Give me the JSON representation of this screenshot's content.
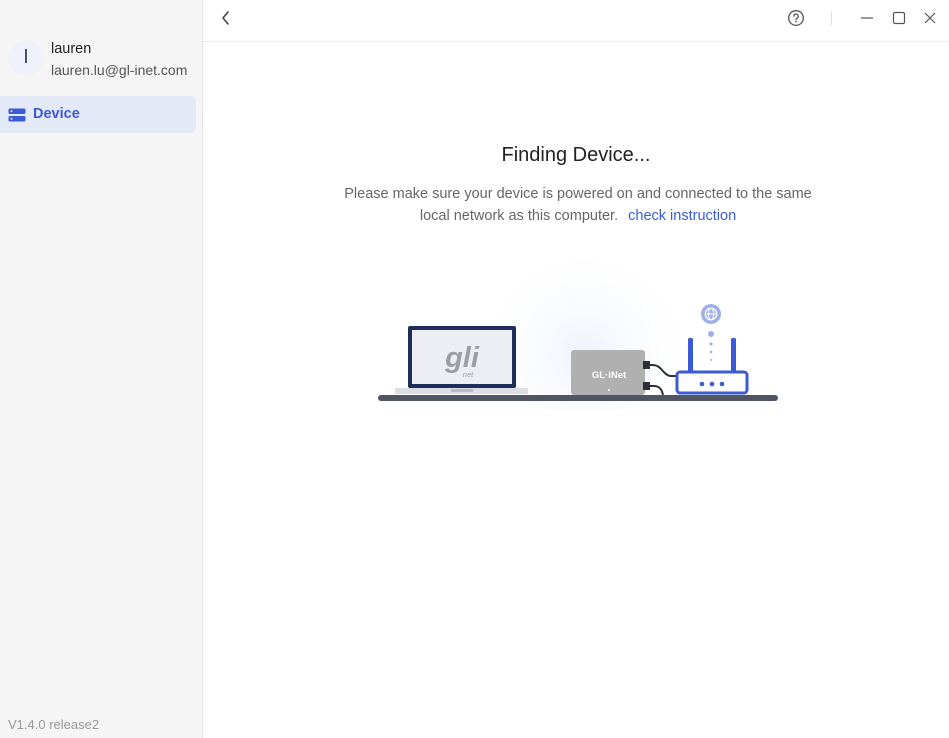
{
  "sidebar": {
    "avatar_initial": "l",
    "user_name": "lauren",
    "user_email": "lauren.lu@gl-inet.com",
    "items": [
      {
        "label": "Device",
        "icon": "server-icon",
        "active": true
      }
    ],
    "version": "V1.4.0 release2"
  },
  "topbar": {
    "back_icon": "chevron-left-icon",
    "help_icon": "question-circle-icon",
    "minimize_icon": "minimize-icon",
    "maximize_icon": "maximize-icon",
    "close_icon": "close-icon"
  },
  "main": {
    "title": "Finding Device...",
    "description": "Please make sure your device is powered on and connected to the same local network as this computer.",
    "link": "check instruction"
  },
  "illustration": {
    "laptop_logo": "gli",
    "laptop_logo_sub": "net",
    "device_label": "GL·iNet"
  },
  "colors": {
    "accent": "#3b5bd6",
    "sidebar_bg": "#f5f5f5",
    "active_item_bg": "#e4e9f8"
  }
}
